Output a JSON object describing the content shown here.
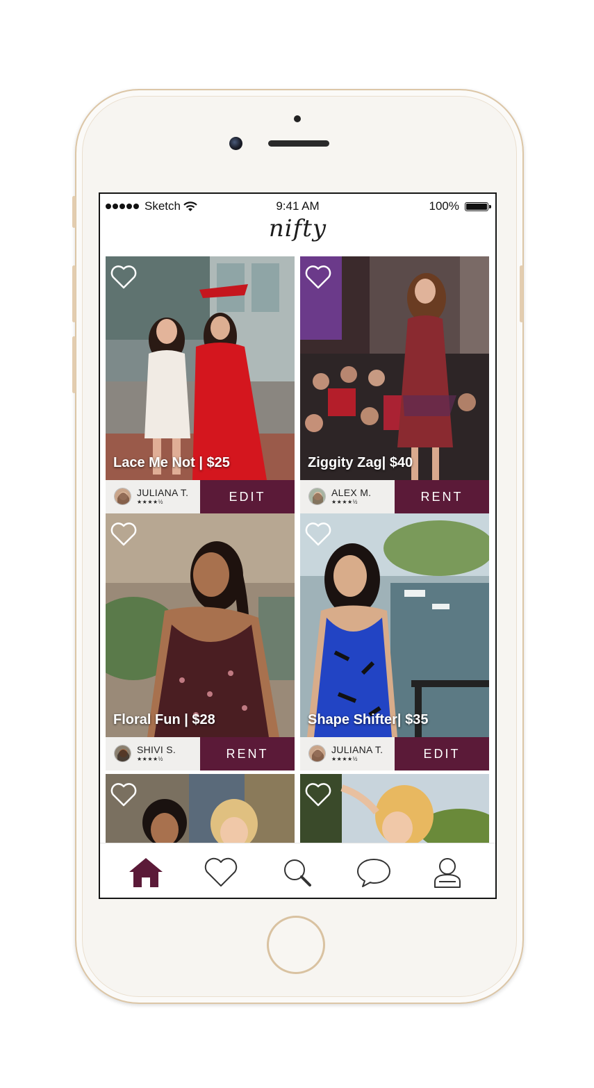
{
  "status_bar": {
    "carrier": "Sketch",
    "time": "9:41 AM",
    "battery": "100%"
  },
  "app": {
    "logo": "nifty"
  },
  "listings": [
    {
      "title": "Lace Me Not | $25",
      "user": "JULIANA T.",
      "rating": "★★★★½",
      "action": "EDIT"
    },
    {
      "title": "Ziggity Zag| $40",
      "user": "ALEX M.",
      "rating": "★★★★½",
      "action": "RENT"
    },
    {
      "title": "Floral Fun | $28",
      "user": "SHIVI S.",
      "rating": "★★★★½",
      "action": "RENT"
    },
    {
      "title": "Shape Shifter| $35",
      "user": "JULIANA T.",
      "rating": "★★★★½",
      "action": "EDIT"
    }
  ],
  "tab_bar": {
    "items": [
      "home-icon",
      "heart-icon",
      "search-icon",
      "chat-icon",
      "profile-icon"
    ],
    "active": "home-icon"
  },
  "colors": {
    "accent": "#5b1a38",
    "tab_inactive": "#333333"
  }
}
